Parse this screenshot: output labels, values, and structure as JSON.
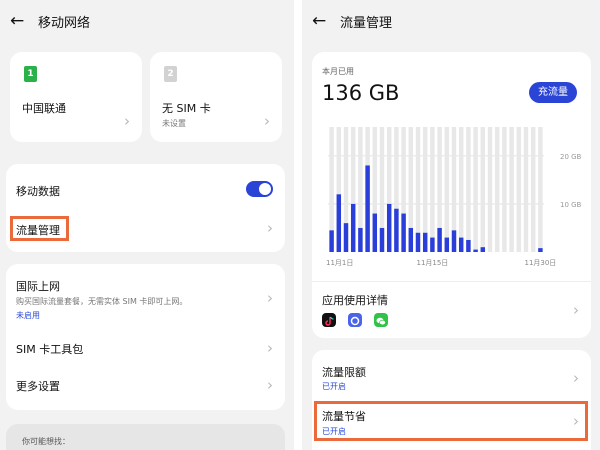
{
  "left": {
    "header": {
      "title": "移动网络"
    },
    "sims": [
      {
        "slot": "1",
        "name": "中国联通",
        "sub": "",
        "color": "#2bb14a"
      },
      {
        "slot": "2",
        "name": "无 SIM 卡",
        "sub": "未设置",
        "color": "#cfcfcf"
      }
    ],
    "mobile_data": {
      "label": "移动数据",
      "enabled": true
    },
    "traffic_mgmt": {
      "label": "流量管理"
    },
    "intl": {
      "label": "国际上网",
      "desc": "购买国际流量套餐，无需实体 SIM 卡即可上网。",
      "status": "未启用"
    },
    "sim_toolkit": {
      "label": "SIM 卡工具包"
    },
    "more_settings": {
      "label": "更多设置"
    },
    "suggest": {
      "label": "你可能想找："
    }
  },
  "right": {
    "header": {
      "title": "流量管理"
    },
    "usage": {
      "label": "本月已用",
      "value": "136 GB",
      "button": "充流量"
    },
    "app_usage": {
      "label": "应用使用详情"
    },
    "limit": {
      "label": "流量限额",
      "status": "已开启"
    },
    "saver": {
      "label": "流量节省",
      "status": "已开启"
    },
    "colors": {
      "accent": "#2a45d6",
      "highlight": "#ea6a3c"
    }
  },
  "chart_data": {
    "type": "bar",
    "y_tick_labels": [
      "20 GB",
      "10 GB"
    ],
    "y_ticks": [
      20,
      10
    ],
    "ylim": [
      0,
      26
    ],
    "x_tick_labels": [
      "11月1日",
      "11月15日",
      "11月30日"
    ],
    "x_tick_days": [
      1,
      15,
      30
    ],
    "days": [
      1,
      2,
      3,
      4,
      5,
      6,
      7,
      8,
      9,
      10,
      11,
      12,
      13,
      14,
      15,
      16,
      17,
      18,
      19,
      20,
      21,
      22,
      23,
      24,
      25,
      26,
      27,
      28,
      29,
      30
    ],
    "values": [
      4.5,
      12,
      6,
      10,
      5,
      18,
      8,
      5,
      10,
      9,
      8,
      5,
      4,
      4,
      3,
      5,
      3,
      4.5,
      3,
      2.5,
      0.5,
      1,
      0,
      0,
      0,
      0,
      0,
      0,
      0,
      0.8
    ],
    "bar_color": "#2a3fd9",
    "track_color": "#e8e8e8",
    "grid": true
  }
}
